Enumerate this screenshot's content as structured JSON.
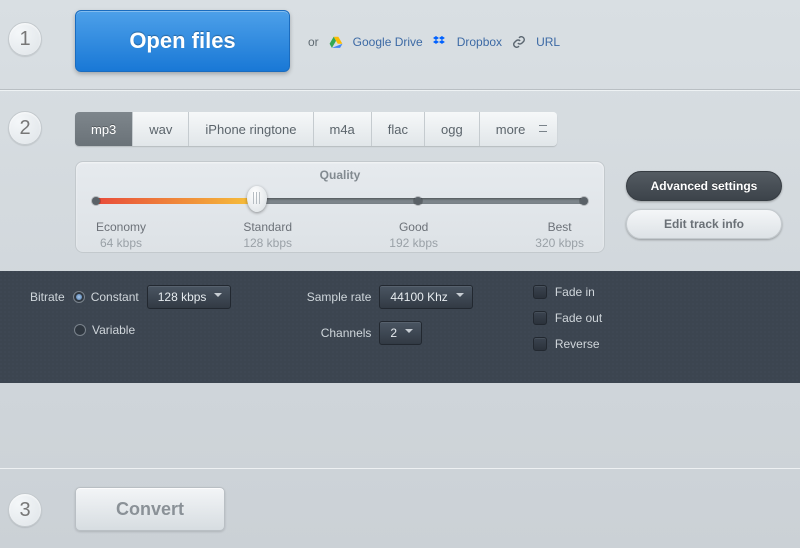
{
  "step1": {
    "number": "1",
    "open_label": "Open files",
    "or_label": "or",
    "sources": {
      "google_drive": "Google Drive",
      "dropbox": "Dropbox",
      "url": "URL"
    }
  },
  "step2": {
    "number": "2",
    "tabs": [
      "mp3",
      "wav",
      "iPhone ringtone",
      "m4a",
      "flac",
      "ogg",
      "more"
    ],
    "active_tab_index": 0,
    "quality": {
      "title": "Quality",
      "slider_percent": 33,
      "stops": [
        {
          "name": "Economy",
          "rate": "64 kbps",
          "pos": 0
        },
        {
          "name": "Standard",
          "rate": "128 kbps",
          "pos": 33
        },
        {
          "name": "Good",
          "rate": "192 kbps",
          "pos": 66
        },
        {
          "name": "Best",
          "rate": "320 kbps",
          "pos": 100
        }
      ]
    },
    "advanced_btn": "Advanced settings",
    "edit_btn": "Edit track info",
    "advanced": {
      "bitrate_label": "Bitrate",
      "bitrate_mode_constant": "Constant",
      "bitrate_mode_variable": "Variable",
      "bitrate_mode_selected": "constant",
      "bitrate_value": "128 kbps",
      "samplerate_label": "Sample rate",
      "samplerate_value": "44100 Khz",
      "channels_label": "Channels",
      "channels_value": "2",
      "fade_in": "Fade in",
      "fade_out": "Fade out",
      "reverse": "Reverse"
    }
  },
  "step3": {
    "number": "3",
    "convert_label": "Convert"
  }
}
